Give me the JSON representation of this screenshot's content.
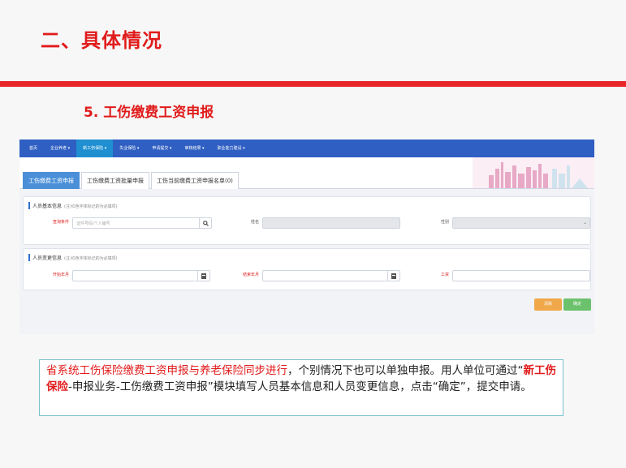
{
  "slide": {
    "title": "二、具体情况",
    "subtitle": "5. 工伤缴费工资申报"
  },
  "nav": {
    "items": [
      {
        "label": "首页"
      },
      {
        "label": "企业养老 ▾"
      },
      {
        "label": "新工伤保险 ▾"
      },
      {
        "label": "失业保险 ▾"
      },
      {
        "label": "申请提交 ▾"
      },
      {
        "label": "审核结果 ▾"
      },
      {
        "label": "职业能力建设 ▾"
      }
    ]
  },
  "tabs": [
    {
      "label": "工伤缴费工资申报"
    },
    {
      "label": "工伤缴费工资批量申报"
    },
    {
      "label": "工伤当前缴费工资申报名单(0)"
    }
  ],
  "basic": {
    "heading": "人员基本信息",
    "hint": "(注:红色字体标记的为必填项)",
    "query_label": "查询条件",
    "query_placeholder": "证件号码/个人编号",
    "name_label": "姓名",
    "gender_label": "性别"
  },
  "change": {
    "heading": "人员变更信息",
    "hint": "(注:红色字体标记的为必填项)",
    "start_label": "开始年月",
    "end_label": "结束年月",
    "wage_label": "工资"
  },
  "buttons": {
    "clear": "清除",
    "confirm": "确定"
  },
  "note": {
    "part1": "省系统工伤保险缴费工资申报与养老保险同步进行",
    "part2": "，个别情况下也可以单独申报。用人单位可通过“",
    "part3": "新工伤保险",
    "part4": "-申报业务-工伤缴费工资申报”模块填写人员基本信息和人员变更信息，点击“确定”，提交申请。"
  },
  "colors": {
    "accent_red": "#e11b1b",
    "nav_blue": "#2f5fc2",
    "active_tab": "#4a8fd8",
    "clear_btn": "#f0a84a",
    "confirm_btn": "#6cc26c"
  }
}
